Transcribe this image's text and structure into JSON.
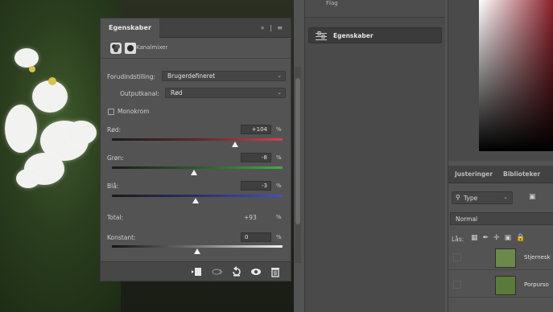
{
  "properties_panel": {
    "tab_title": "Egenskaber",
    "header_controls": "» | ≡",
    "adjustment_name": "Kanalmixer",
    "preset_label": "Forudindstilling:",
    "preset_value": "Brugerdefineret",
    "output_channel_label": "Outputkanal:",
    "output_channel_value": "Rød",
    "monochrome_label": "Monokrom",
    "channels": [
      {
        "label": "Rød:",
        "value": "+104",
        "unit": "%",
        "slider_fraction": 0.72
      },
      {
        "label": "Grøn:",
        "value": "-8",
        "unit": "%",
        "slider_fraction": 0.48
      },
      {
        "label": "Blå:",
        "value": "-3",
        "unit": "%",
        "slider_fraction": 0.49
      }
    ],
    "total_label": "Total:",
    "total_value": "+93",
    "total_unit": "%",
    "constant_label": "Konstant:",
    "constant_value": "0",
    "constant_unit": "%",
    "constant_fraction": 0.5
  },
  "middle_panel": {
    "top_label": "Flag",
    "egenskaber_label": "Egenskaber"
  },
  "right_panel": {
    "tabs": [
      "Justeringer",
      "Biblioteker"
    ],
    "filter_type": "Type",
    "blend_mode": "Normal",
    "lock_label": "Lås:",
    "layers": [
      {
        "name": "Stjernesk"
      },
      {
        "name": "Porpurso"
      }
    ]
  },
  "colors": {
    "panel_bg": "#535353",
    "red_track": "#c9404a",
    "green_track": "#3fa03f",
    "blue_track": "#3c4fb8"
  }
}
